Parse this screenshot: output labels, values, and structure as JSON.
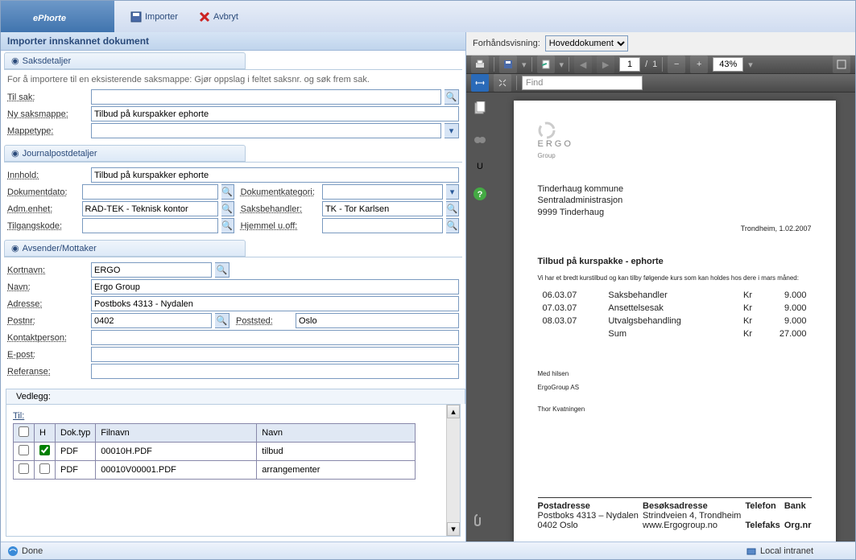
{
  "brand": "ePhorte",
  "header": {
    "import": "Importer",
    "cancel": "Avbryt"
  },
  "page_title": "Importer innskannet dokument",
  "sections": {
    "saks": {
      "title": "Saksdetaljer",
      "hint": "For å importere til en eksisterende saksmappe: Gjør oppslag i feltet saksnr. og søk frem sak.",
      "til_sak_lbl": "Til sak:",
      "til_sak": "",
      "ny_lbl": "Ny saksmappe:",
      "ny": "Tilbud på kurspakker ephorte",
      "mappetype_lbl": "Mappetype:",
      "mappetype": ""
    },
    "journal": {
      "title": "Journalpostdetaljer",
      "innhold_lbl": "Innhold:",
      "innhold": "Tilbud på kurspakker ephorte",
      "dokdato_lbl": "Dokumentdato:",
      "dokdato": "",
      "dokkat_lbl": "Dokumentkategori:",
      "dokkat": "",
      "adm_lbl": "Adm.enhet:",
      "adm": "RAD-TEK - Teknisk kontor",
      "saksb_lbl": "Saksbehandler:",
      "saksb": "TK - Tor Karlsen",
      "tilg_lbl": "Tilgangskode:",
      "tilg": "",
      "hjemmel_lbl": "Hjemmel u.off:",
      "hjemmel": ""
    },
    "avsender": {
      "title": "Avsender/Mottaker",
      "kort_lbl": "Kortnavn:",
      "kort": "ERGO",
      "navn_lbl": "Navn:",
      "navn": "Ergo Group",
      "adr_lbl": "Adresse:",
      "adr": "Postboks 4313 - Nydalen",
      "postnr_lbl": "Postnr:",
      "postnr": "0402",
      "poststed_lbl": "Poststed:",
      "poststed": "Oslo",
      "kontakt_lbl": "Kontaktperson:",
      "kontakt": "",
      "epost_lbl": "E-post:",
      "epost": "",
      "ref_lbl": "Referanse:",
      "ref": ""
    }
  },
  "vedlegg": {
    "tab": "Vedlegg:",
    "til": "Til:",
    "cols": {
      "h": "H",
      "dok": "Dok.typ",
      "fil": "Filnavn",
      "navn": "Navn"
    },
    "rows": [
      {
        "checked": true,
        "doktyp": "PDF",
        "filnavn": "00010H.PDF",
        "navn": "tilbud"
      },
      {
        "checked": false,
        "doktyp": "PDF",
        "filnavn": "00010V00001.PDF",
        "navn": "arrangementer"
      }
    ]
  },
  "preview": {
    "label": "Forhåndsvisning:",
    "selected": "Hoveddokument",
    "page_cur": "1",
    "page_sep": "/",
    "page_tot": "1",
    "zoom": "43%",
    "find": "Find"
  },
  "doc": {
    "logo": "ERGO",
    "logo_sub": "Group",
    "addr1": "Tinderhaug kommune",
    "addr2": "Sentraladministrasjon",
    "addr3": "9999 Tinderhaug",
    "date": "Trondheim, 1.02.2007",
    "title": "Tilbud på kurspakke - ephorte",
    "intro": "Vi har et bredt kurstilbud og kan tilby følgende kurs som kan holdes hos dere i mars måned:",
    "rows": [
      {
        "d": "06.03.07",
        "t": "Saksbehandler",
        "k": "Kr",
        "v": "9.000"
      },
      {
        "d": "07.03.07",
        "t": "Ansettelsesak",
        "k": "Kr",
        "v": "9.000"
      },
      {
        "d": "08.03.07",
        "t": "Utvalgsbehandling",
        "k": "Kr",
        "v": "9.000"
      }
    ],
    "sum_lbl": "Sum",
    "sum_k": "Kr",
    "sum_v": "27.000",
    "regards": "Med hilsen",
    "company": "ErgoGroup AS",
    "sign": "Thor Kvatningen",
    "foot": {
      "pa": "Postadresse",
      "pa1": "Postboks 4313 – Nydalen",
      "pa2": "0402 Oslo",
      "ba": "Besøksadresse",
      "ba1": "Strindveien 4, Trondheim",
      "ba2": "www.Ergogroup.no",
      "tf": "Telefon",
      "tx": "Telefaks",
      "bk": "Bank",
      "on": "Org.nr"
    }
  },
  "status": {
    "done": "Done",
    "zone": "Local intranet"
  }
}
